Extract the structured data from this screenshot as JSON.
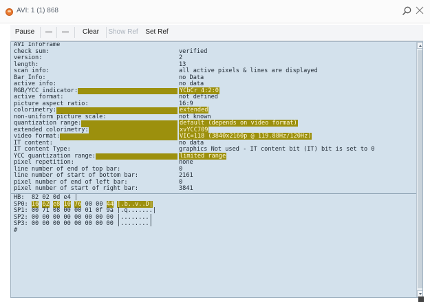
{
  "window": {
    "title": "AVI: 1 (1) 868",
    "icon": "app-icon",
    "search_icon": "search-icon",
    "close_icon": "close-icon"
  },
  "toolbar": {
    "pause": "Pause",
    "minus1": "—",
    "minus2": "—",
    "clear": "Clear",
    "show_ref": "Show Ref",
    "set_ref": "Set Ref"
  },
  "console": {
    "header": "AVI InfoFrame",
    "fields": [
      {
        "key": "check sum:",
        "value": "verified",
        "hl": false
      },
      {
        "key": "version:",
        "value": "2",
        "hl": false
      },
      {
        "key": "length:",
        "value": "13",
        "hl": false
      },
      {
        "key": "scan info:",
        "value": "all active pixels & lines are displayed",
        "hl": false
      },
      {
        "key": "Bar Info:",
        "value": "no Data",
        "hl": false
      },
      {
        "key": "active info:",
        "value": "no data",
        "hl": false
      },
      {
        "key": "RGB/YCC indicator:",
        "value": "YCbCr 4:2:0",
        "hl": true
      },
      {
        "key": "active format:",
        "value": "not defined",
        "hl": false
      },
      {
        "key": "picture aspect ratio:",
        "value": "16:9",
        "hl": false
      },
      {
        "key": "colorimetry:",
        "value": "extended",
        "hl": true
      },
      {
        "key": "non-uniform picture scale:",
        "value": "not known",
        "hl": false
      },
      {
        "key": "quantization range:",
        "value": "default (depends on video format)",
        "hl": true
      },
      {
        "key": "extended colorimetry:",
        "value": "xvYCC709",
        "hl": true
      },
      {
        "key": "video format:",
        "value": "VIC=118 (3840x2160p @ 119.88Hz/120Hz)",
        "hl": true
      },
      {
        "key": "IT content:",
        "value": "no data",
        "hl": false
      },
      {
        "key": "IT content Type:",
        "value": "graphics Not used - IT content bit (IT) bit is set to 0",
        "hl": false
      },
      {
        "key": "YCC quantization range:",
        "value": "limited range",
        "hl": true
      },
      {
        "key": "pixel repetition:",
        "value": "none",
        "hl": false
      },
      {
        "key": "line number of end of top bar:",
        "value": "0",
        "hl": false
      },
      {
        "key": "line number of start of bottom bar:",
        "value": "2161",
        "hl": false
      },
      {
        "key": "pixel number of end of left bar:",
        "value": "0",
        "hl": false
      },
      {
        "key": "pixel number of start of right bar:",
        "value": "3841",
        "hl": false
      }
    ],
    "hex": {
      "hb": "HB:  82 02 0d e4 |",
      "sp0_label": "SP0:",
      "sp0_bytes": [
        "16",
        "62",
        "e8",
        "10",
        "76",
        "00",
        "00",
        "44"
      ],
      "sp0_hl": [
        true,
        true,
        true,
        true,
        true,
        false,
        false,
        true
      ],
      "sp0_ascii": "|.b..v..D|",
      "sp1": "SP1: 00 71 08 00 00 01 0f 9a |.q.......|",
      "sp2": "SP2: 00 00 00 00 00 00 00 00 |........|",
      "sp3": "SP3: 00 00 00 00 00 00 00 00 |........|",
      "prompt": "#"
    }
  },
  "colors": {
    "console_bg": "#d3e1ec",
    "highlight": "#9c900d",
    "text": "#1e2832"
  }
}
